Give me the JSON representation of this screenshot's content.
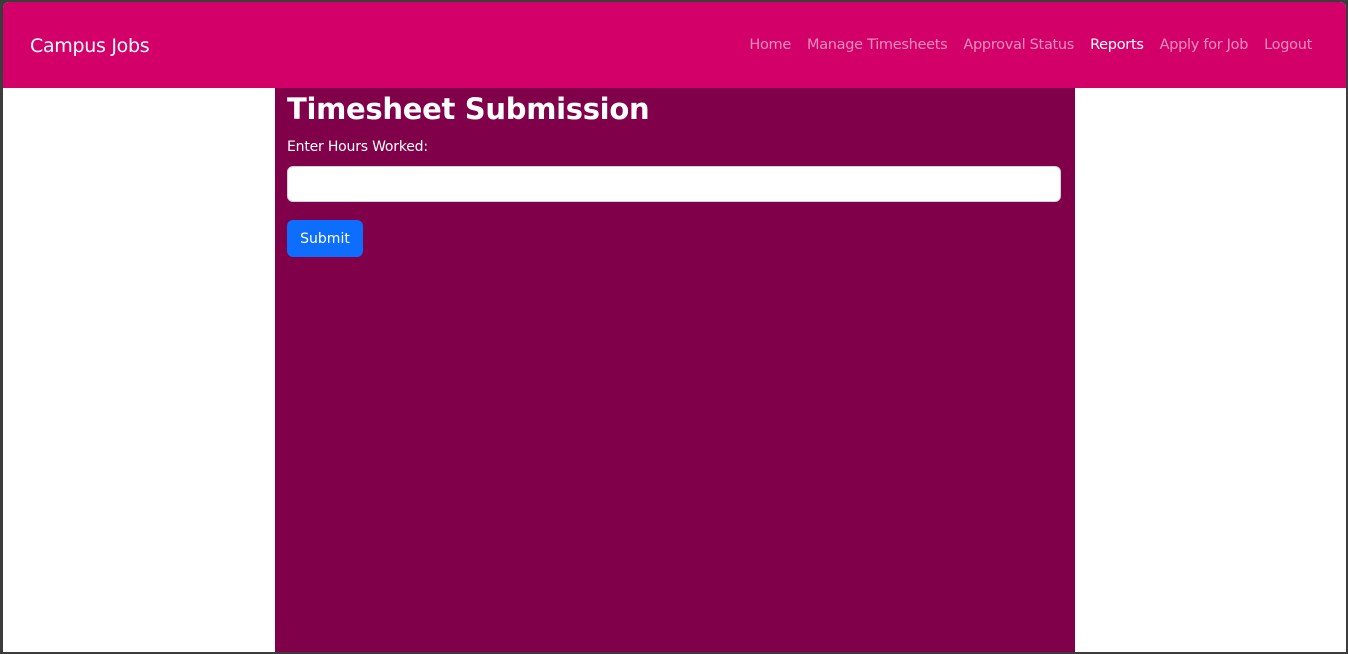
{
  "navbar": {
    "brand": "Campus Jobs",
    "links": [
      {
        "label": "Home",
        "active": false
      },
      {
        "label": "Manage Timesheets",
        "active": false
      },
      {
        "label": "Approval Status",
        "active": false
      },
      {
        "label": "Reports",
        "active": true
      },
      {
        "label": "Apply for Job",
        "active": false
      },
      {
        "label": "Logout",
        "active": false
      }
    ]
  },
  "main": {
    "title": "Timesheet Submission",
    "hours_label": "Enter Hours Worked:",
    "hours_value": "",
    "submit_label": "Submit"
  },
  "colors": {
    "navbar": "#d4006a",
    "content": "#800049",
    "button": "#0d6efd"
  }
}
